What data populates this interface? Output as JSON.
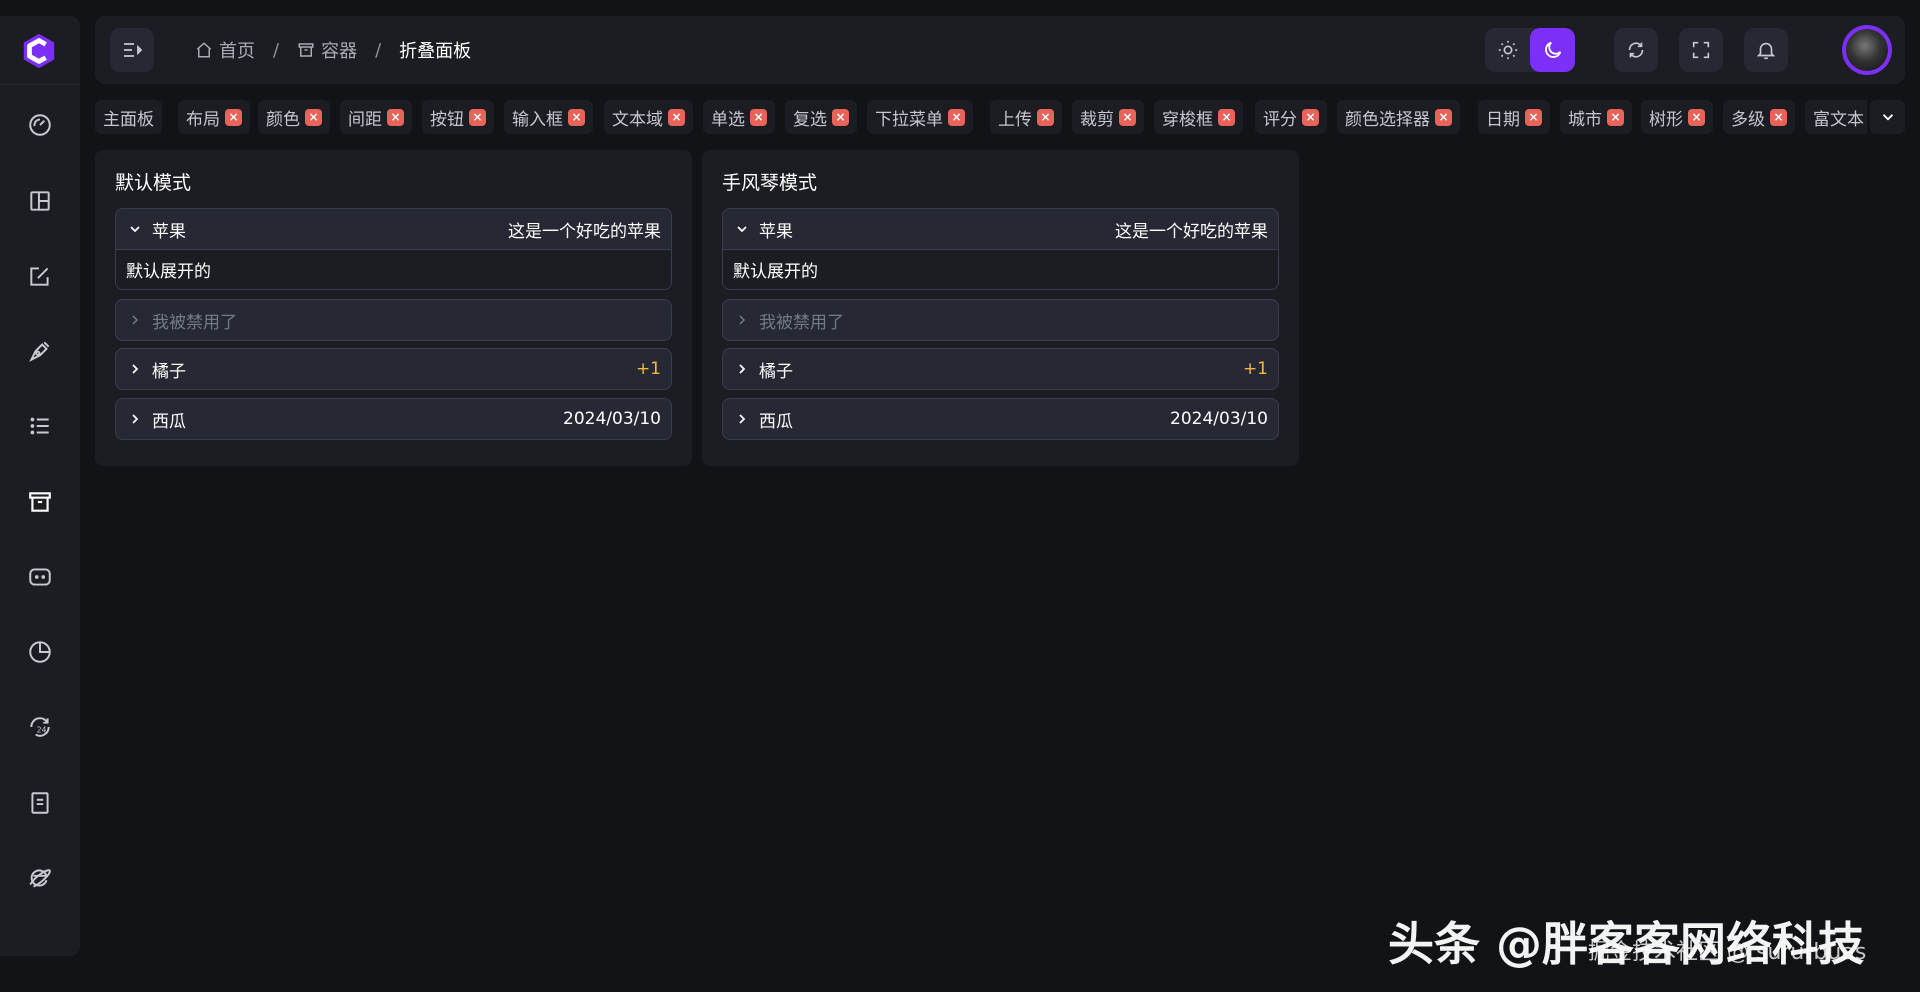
{
  "breadcrumb": {
    "items": [
      {
        "label": "首页",
        "icon": "home-icon"
      },
      {
        "label": "容器",
        "icon": "archive-icon"
      },
      {
        "label": "折叠面板"
      }
    ],
    "separator": "/"
  },
  "tabs": [
    {
      "label": "主面板",
      "closable": false
    },
    {
      "label": "布局",
      "closable": true
    },
    {
      "label": "颜色",
      "closable": true
    },
    {
      "label": "间距",
      "closable": true
    },
    {
      "label": "按钮",
      "closable": true
    },
    {
      "label": "输入框",
      "closable": true
    },
    {
      "label": "文本域",
      "closable": true
    },
    {
      "label": "单选",
      "closable": true
    },
    {
      "label": "复选",
      "closable": true
    },
    {
      "label": "下拉菜单",
      "closable": true
    },
    {
      "label": "上传",
      "closable": true
    },
    {
      "label": "裁剪",
      "closable": true
    },
    {
      "label": "穿梭框",
      "closable": true
    },
    {
      "label": "评分",
      "closable": true
    },
    {
      "label": "颜色选择器",
      "closable": true
    },
    {
      "label": "日期",
      "closable": true
    },
    {
      "label": "城市",
      "closable": true
    },
    {
      "label": "树形",
      "closable": true
    },
    {
      "label": "多级",
      "closable": true
    },
    {
      "label": "富文本",
      "closable": false
    }
  ],
  "cards": [
    {
      "title": "默认模式",
      "panels": [
        {
          "title": "苹果",
          "extra": "这是一个好吃的苹果",
          "body": "默认展开的",
          "expanded": true,
          "disabled": false
        },
        {
          "title": "我被禁用了",
          "extra": "",
          "expanded": false,
          "disabled": true
        },
        {
          "title": "橘子",
          "extra": "+1",
          "expanded": false,
          "disabled": false,
          "badge": true
        },
        {
          "title": "西瓜",
          "extra": "2024/03/10",
          "expanded": false,
          "disabled": false
        }
      ]
    },
    {
      "title": "手风琴模式",
      "panels": [
        {
          "title": "苹果",
          "extra": "这是一个好吃的苹果",
          "body": "默认展开的",
          "expanded": true,
          "disabled": false
        },
        {
          "title": "我被禁用了",
          "extra": "",
          "expanded": false,
          "disabled": true
        },
        {
          "title": "橘子",
          "extra": "+1",
          "expanded": false,
          "disabled": false,
          "badge": true
        },
        {
          "title": "西瓜",
          "extra": "2024/03/10",
          "expanded": false,
          "disabled": false
        }
      ]
    }
  ],
  "sidebar": {
    "icons": [
      "dashboard-icon",
      "layout-icon",
      "edit-icon",
      "pen-tool-icon",
      "list-icon",
      "archive-icon",
      "robot-icon",
      "pie-chart-icon",
      "history-24-icon",
      "document-icon",
      "ie-browser-icon"
    ],
    "active_index": 5
  },
  "theme": {
    "active": "dark",
    "accent": "#7b2ff7"
  },
  "watermark": {
    "main": "头条 @胖客客网络科技",
    "sub": "掘金技术社区 @ sururbuas"
  }
}
